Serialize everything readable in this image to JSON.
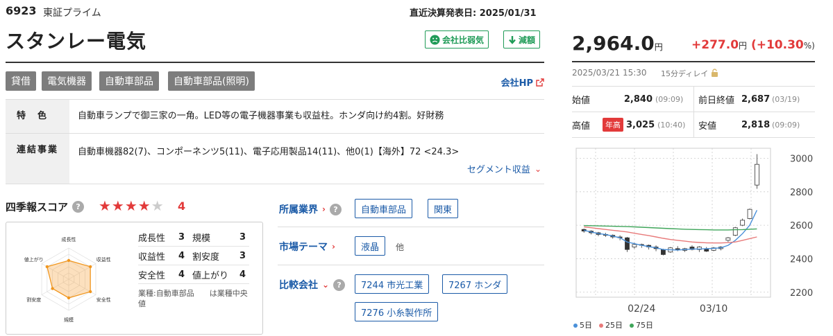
{
  "header": {
    "code": "6923",
    "market": "東証プライム",
    "settlement": "直近決算発表日: 2025/01/31",
    "name": "スタンレー電気",
    "badge_weak": "会社比弱気",
    "badge_down": "減額"
  },
  "tags": [
    "貸借",
    "電気機器",
    "自動車部品",
    "自動車部品(照明)"
  ],
  "company_hp": "会社HP",
  "info": {
    "feature_label": "特　色",
    "feature_text": "自動車ランプで御三家の一角。LED等の電子機器事業も収益柱。ホンダ向け約4割。好財務",
    "segment_label": "連結事業",
    "segment_text": "自動車機器82(7)、コンポーネンツ5(11)、電子応用製品14(11)、他0(1)【海外】72 <24.3>",
    "segment_link": "セグメント収益"
  },
  "score": {
    "title": "四季報スコア",
    "stars": "★★★★",
    "stars_off": "★",
    "value": "4",
    "items": [
      {
        "label": "成長性",
        "value": "3"
      },
      {
        "label": "規模",
        "value": "3"
      },
      {
        "label": "収益性",
        "value": "4"
      },
      {
        "label": "割安度",
        "value": "3"
      },
      {
        "label": "安全性",
        "value": "4"
      },
      {
        "label": "値上がり",
        "value": "4"
      }
    ],
    "note": "業種:自動車部品　　は業種中央値",
    "radar_labels": [
      "成長性",
      "収益性",
      "安全性",
      "規模",
      "割安度",
      "値上がり"
    ],
    "radar_values": [
      3,
      4,
      4,
      3,
      3,
      4
    ]
  },
  "side": {
    "industry_label": "所属業界",
    "industry_tags": [
      "自動車部品",
      "関東"
    ],
    "theme_label": "市場テーマ",
    "theme_tags": [
      "液晶"
    ],
    "theme_more": "他",
    "peers_label": "比較会社",
    "peer_tags": [
      "7244 市光工業",
      "7267 ホンダ",
      "7276 小糸製作所"
    ]
  },
  "quote": {
    "price": "2,964.0",
    "price_unit": "円",
    "change": "+277.0",
    "change_unit": "円",
    "change_pct": "(+10.30",
    "change_pct_unit": "%)",
    "timestamp": "2025/03/21 15:30",
    "delay": "15分ディレイ",
    "open_label": "始値",
    "open": "2,840",
    "open_time": "(09:09)",
    "prev_label": "前日終値",
    "prev": "2,687",
    "prev_time": "(03/19)",
    "high_label": "高値",
    "high_badge": "年高",
    "high": "3,025",
    "high_time": "(10:40)",
    "low_label": "安値",
    "low": "2,818",
    "low_time": "(09:09)"
  },
  "chart_data": {
    "type": "candlestick",
    "x_ticks": [
      "02/24",
      "03/10"
    ],
    "y_ticks": [
      "3000",
      "2800",
      "2600",
      "2400",
      "2200"
    ],
    "ylim": [
      2200,
      3000
    ],
    "candles": [
      [
        2575,
        2580,
        2555,
        2565
      ],
      [
        2565,
        2570,
        2545,
        2555
      ],
      [
        2555,
        2560,
        2535,
        2545
      ],
      [
        2545,
        2555,
        2530,
        2540
      ],
      [
        2540,
        2545,
        2520,
        2530
      ],
      [
        2530,
        2540,
        2510,
        2525
      ],
      [
        2525,
        2530,
        2440,
        2455
      ],
      [
        2470,
        2495,
        2460,
        2485
      ],
      [
        2485,
        2490,
        2465,
        2480
      ],
      [
        2480,
        2485,
        2455,
        2470
      ],
      [
        2470,
        2480,
        2445,
        2460
      ],
      [
        2455,
        2460,
        2420,
        2425
      ],
      [
        2440,
        2470,
        2435,
        2465
      ],
      [
        2460,
        2475,
        2445,
        2455
      ],
      [
        2450,
        2465,
        2440,
        2460
      ],
      [
        2470,
        2480,
        2450,
        2455
      ],
      [
        2455,
        2475,
        2440,
        2470
      ],
      [
        2460,
        2470,
        2440,
        2445
      ],
      [
        2450,
        2470,
        2445,
        2465
      ],
      [
        2460,
        2475,
        2450,
        2470
      ],
      [
        2510,
        2530,
        2500,
        2525
      ],
      [
        2540,
        2590,
        2535,
        2585
      ],
      [
        2600,
        2640,
        2595,
        2630
      ],
      [
        2640,
        2700,
        2635,
        2695
      ],
      [
        2840,
        3025,
        2818,
        2964
      ]
    ],
    "series": [
      {
        "name": "5日",
        "color": "#4a90d9",
        "values": [
          2570,
          2560,
          2550,
          2545,
          2535,
          2525,
          2500,
          2490,
          2480,
          2472,
          2465,
          2455,
          2453,
          2452,
          2455,
          2458,
          2458,
          2460,
          2462,
          2465,
          2480,
          2510,
          2550,
          2600,
          2690
        ]
      },
      {
        "name": "25日",
        "color": "#e87a7a",
        "values": [
          2590,
          2585,
          2580,
          2575,
          2570,
          2565,
          2560,
          2552,
          2545,
          2538,
          2530,
          2522,
          2515,
          2510,
          2505,
          2500,
          2497,
          2495,
          2494,
          2494,
          2496,
          2500,
          2510,
          2520,
          2530
        ]
      },
      {
        "name": "75日",
        "color": "#3fa55a",
        "values": [
          2598,
          2597,
          2596,
          2595,
          2594,
          2593,
          2592,
          2590,
          2588,
          2586,
          2584,
          2582,
          2580,
          2578,
          2576,
          2575,
          2574,
          2573,
          2572,
          2572,
          2572,
          2573,
          2574,
          2576,
          2578
        ]
      }
    ]
  }
}
